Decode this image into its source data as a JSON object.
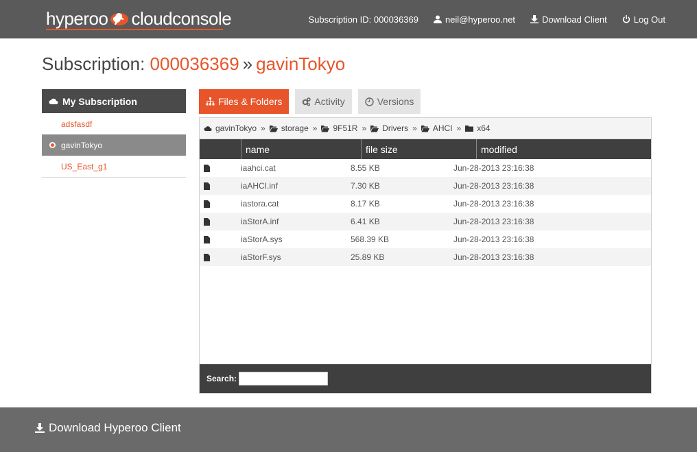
{
  "header": {
    "logo_left": "hyperoo",
    "logo_right": "cloudconsole",
    "subscription_label": "Subscription ID: 000036369",
    "user_email": "neil@hyperoo.net",
    "download_client": "Download Client",
    "logout": "Log Out",
    "accent_color": "#e8552a"
  },
  "title": {
    "prefix": "Subscription: ",
    "subscription_id": "000036369",
    "separator": "»",
    "computer": "gavinTokyo"
  },
  "sidebar": {
    "heading": "My Subscription",
    "items": [
      {
        "label": "adsfasdf",
        "active": false
      },
      {
        "label": "gavinTokyo",
        "active": true
      },
      {
        "label": "US_East_g1",
        "active": false
      }
    ]
  },
  "tabs": [
    {
      "label": "Files & Folders",
      "icon": "sitemap-icon",
      "active": true
    },
    {
      "label": "Activity",
      "icon": "gears-icon",
      "active": false
    },
    {
      "label": "Versions",
      "icon": "clock-icon",
      "active": false
    }
  ],
  "breadcrumb": {
    "separator": "»",
    "items": [
      {
        "label": "gavinTokyo",
        "icon": "cloud-icon"
      },
      {
        "label": "storage",
        "icon": "folder-open-icon"
      },
      {
        "label": "9F51R",
        "icon": "folder-open-icon"
      },
      {
        "label": "Drivers",
        "icon": "folder-open-icon"
      },
      {
        "label": "AHCI",
        "icon": "folder-open-icon"
      },
      {
        "label": "x64",
        "icon": "folder-icon"
      }
    ]
  },
  "table": {
    "columns": [
      "name",
      "file size",
      "modified"
    ],
    "rows": [
      {
        "name": "iaahci.cat",
        "size": "8.55 KB",
        "modified": "Jun-28-2013 23:16:38"
      },
      {
        "name": "iaAHCI.inf",
        "size": "7.30 KB",
        "modified": "Jun-28-2013 23:16:38"
      },
      {
        "name": "iastora.cat",
        "size": "8.17 KB",
        "modified": "Jun-28-2013 23:16:38"
      },
      {
        "name": "iaStorA.inf",
        "size": "6.41 KB",
        "modified": "Jun-28-2013 23:16:38"
      },
      {
        "name": "iaStorA.sys",
        "size": "568.39 KB",
        "modified": "Jun-28-2013 23:16:38"
      },
      {
        "name": "iaStorF.sys",
        "size": "25.89 KB",
        "modified": "Jun-28-2013 23:16:38"
      }
    ]
  },
  "search": {
    "label": "Search:",
    "value": ""
  },
  "footer": {
    "download_label": "Download Hyperoo Client"
  }
}
